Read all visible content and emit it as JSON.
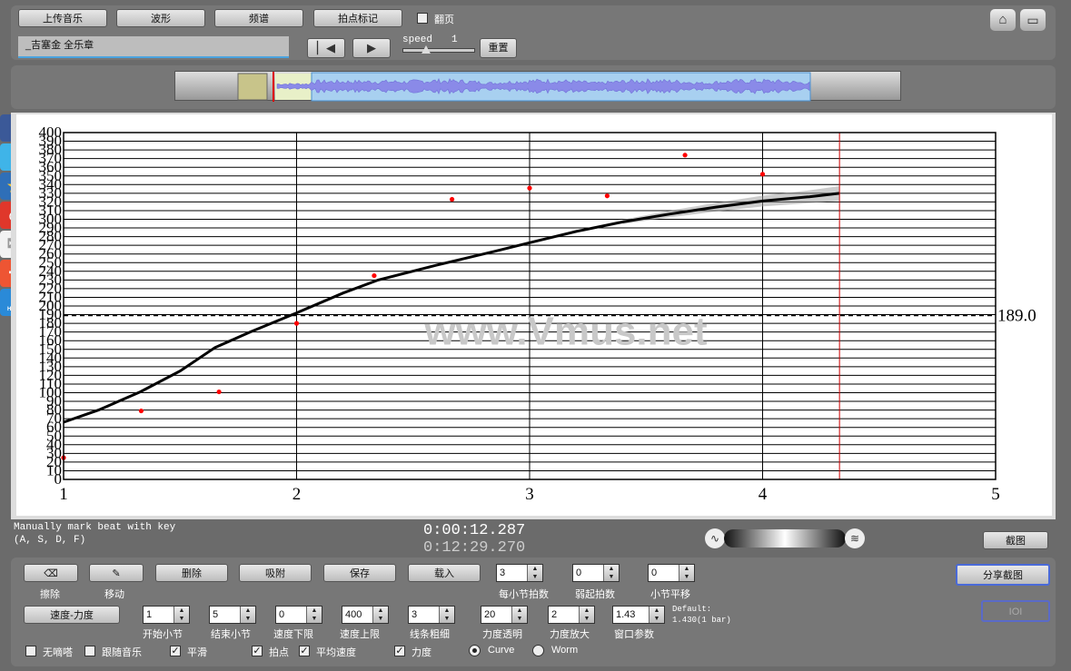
{
  "toolbar": {
    "upload_music": "上传音乐",
    "waveform": "波形",
    "spectrum": "频谱",
    "mark_beats": "拍点标记",
    "page_turn": "翻页",
    "song_title": "_吉塞金 全乐章",
    "speed_label": "speed",
    "speed_value": "1",
    "reset": "重置"
  },
  "social_icons": [
    "facebook-icon",
    "twitter-icon",
    "star-icon",
    "weibo-icon",
    "mail-icon",
    "plus-icon",
    "help-icon"
  ],
  "social_help_text": "HELP",
  "status": {
    "hint_line1": "Manually mark beat with key",
    "hint_line2": "(A, S, D, F)",
    "current_time": "0:00:12.287",
    "total_time": "0:12:29.270",
    "screenshot": "截图"
  },
  "controls": {
    "erase": "擦除",
    "move": "移动",
    "delete": "删除",
    "snap": "吸附",
    "save": "保存",
    "load": "载入",
    "beats_per_bar_value": "3",
    "beats_per_bar_label": "每小节拍数",
    "pickup_value": "0",
    "pickup_label": "弱起拍数",
    "bar_shift_value": "0",
    "bar_shift_label": "小节平移",
    "share_screenshot": "分享截图",
    "ioi": "IOI",
    "tempo_dynamics": "速度-力度",
    "start_bar_value": "1",
    "start_bar_label": "开始小节",
    "end_bar_value": "5",
    "end_bar_label": "结束小节",
    "tempo_min_value": "0",
    "tempo_min_label": "速度下限",
    "tempo_max_value": "400",
    "tempo_max_label": "速度上限",
    "line_width_value": "3",
    "line_width_label": "线条粗细",
    "dyn_alpha_value": "20",
    "dyn_alpha_label": "力度透明",
    "dyn_scale_value": "2",
    "dyn_scale_label": "力度放大",
    "window_value": "1.43",
    "window_label": "窗口参数",
    "default_line1": "Default:",
    "default_line2": "1.430(1 bar)",
    "metronome": "无嘀嗒",
    "follow_music": "跟随音乐",
    "smooth": "平滑",
    "beats": "拍点",
    "avg_tempo": "平均速度",
    "dynamics": "力度",
    "curve": "Curve",
    "worm": "Worm"
  },
  "chart_data": {
    "type": "line",
    "x_range": [
      1,
      5
    ],
    "y_range": [
      0,
      400
    ],
    "x_ticks": [
      "1",
      "2",
      "3",
      "4",
      "5"
    ],
    "y_ticks": [
      "0",
      "10",
      "20",
      "30",
      "40",
      "50",
      "60",
      "70",
      "80",
      "90",
      "100",
      "110",
      "120",
      "130",
      "140",
      "150",
      "160",
      "170",
      "180",
      "190",
      "200",
      "210",
      "220",
      "230",
      "240",
      "250",
      "260",
      "270",
      "280",
      "290",
      "300",
      "310",
      "320",
      "330",
      "340",
      "350",
      "360",
      "370",
      "380",
      "390",
      "400"
    ],
    "watermark": "www.Vmus.net",
    "average_line": 189.0,
    "average_label": "189.0",
    "current_position": 4.33,
    "beat_points": [
      {
        "x": 1.0,
        "y": 25
      },
      {
        "x": 1.333,
        "y": 79
      },
      {
        "x": 1.667,
        "y": 101
      },
      {
        "x": 2.0,
        "y": 180
      },
      {
        "x": 2.333,
        "y": 235
      },
      {
        "x": 2.667,
        "y": 323
      },
      {
        "x": 3.0,
        "y": 336
      },
      {
        "x": 3.333,
        "y": 327
      },
      {
        "x": 3.667,
        "y": 374
      },
      {
        "x": 4.0,
        "y": 352
      }
    ],
    "smoothed_tempo": [
      {
        "x": 1.0,
        "y": 66
      },
      {
        "x": 1.15,
        "y": 80
      },
      {
        "x": 1.33,
        "y": 101
      },
      {
        "x": 1.5,
        "y": 125
      },
      {
        "x": 1.65,
        "y": 152
      },
      {
        "x": 1.8,
        "y": 170
      },
      {
        "x": 2.0,
        "y": 192
      },
      {
        "x": 2.2,
        "y": 215
      },
      {
        "x": 2.35,
        "y": 230
      },
      {
        "x": 2.6,
        "y": 247
      },
      {
        "x": 2.85,
        "y": 263
      },
      {
        "x": 3.0,
        "y": 273
      },
      {
        "x": 3.2,
        "y": 286
      },
      {
        "x": 3.4,
        "y": 297
      },
      {
        "x": 3.6,
        "y": 306
      },
      {
        "x": 3.8,
        "y": 314
      },
      {
        "x": 4.0,
        "y": 321
      },
      {
        "x": 4.2,
        "y": 326
      },
      {
        "x": 4.33,
        "y": 330
      }
    ],
    "colors": {
      "curve": "#000000",
      "points": "#ff0000",
      "cursor": "#cc0000",
      "band": "#999999"
    }
  }
}
